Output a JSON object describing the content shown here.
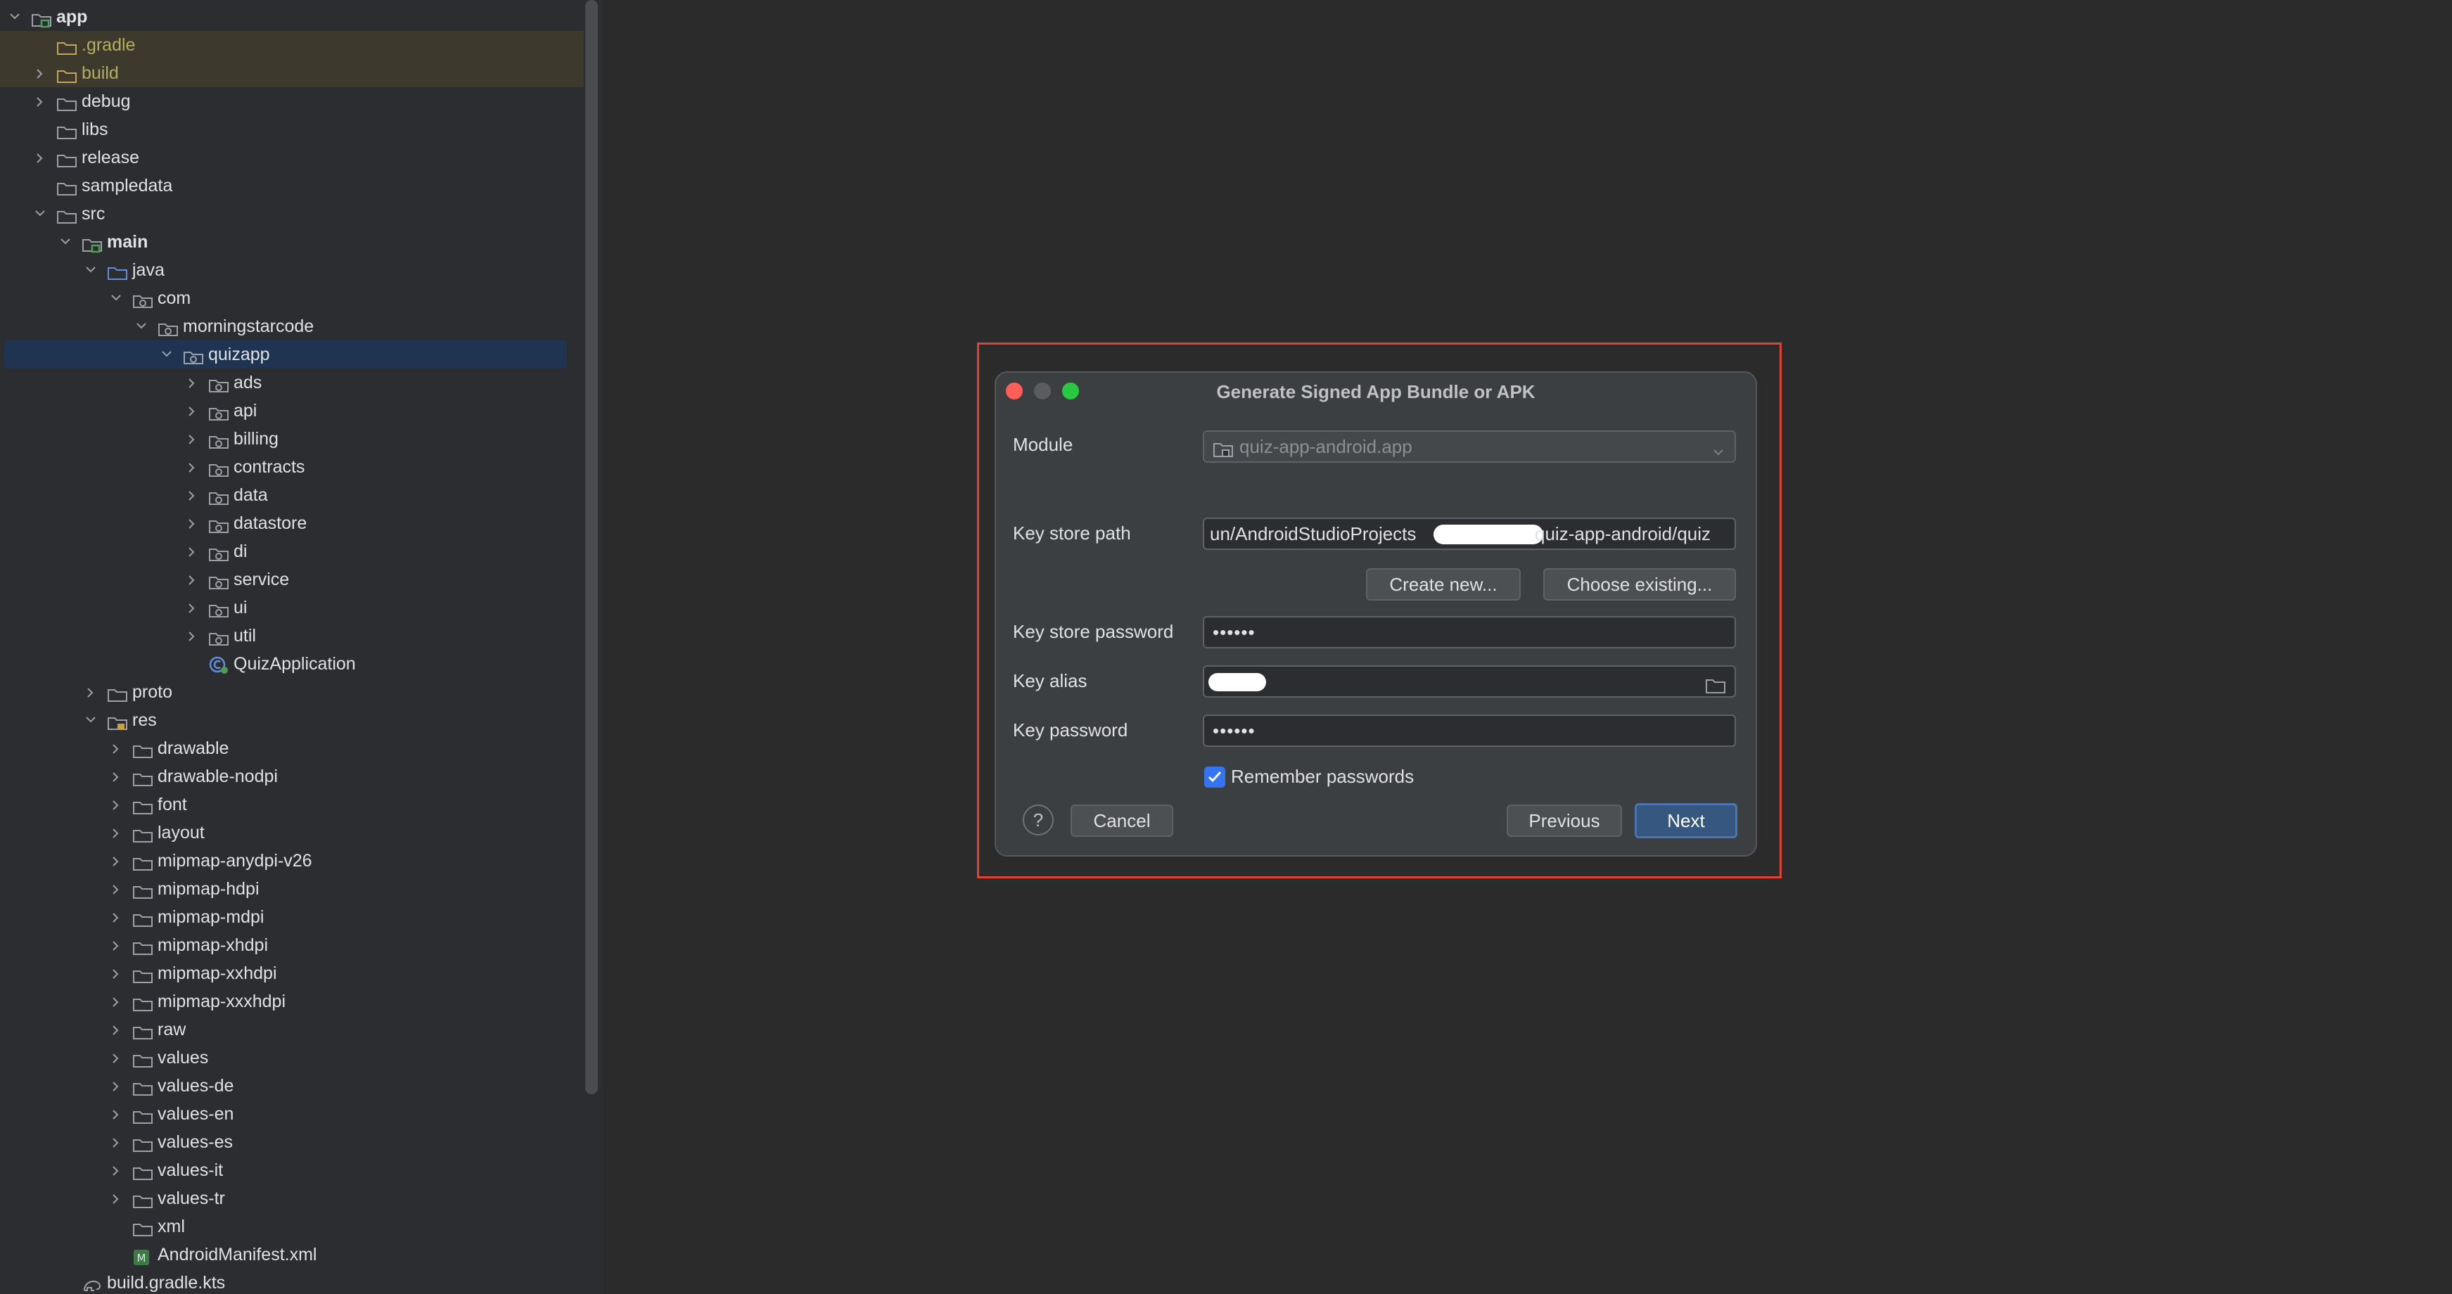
{
  "tree": {
    "items": [
      {
        "label": "app",
        "depth": 0,
        "chevron": "down",
        "icon": "module",
        "bold": true
      },
      {
        "label": ".gradle",
        "depth": 1,
        "chevron": "none",
        "icon": "folder-excluded",
        "highlight": true,
        "excluded": true
      },
      {
        "label": "build",
        "depth": 1,
        "chevron": "right",
        "icon": "folder-excluded",
        "highlight": true,
        "excluded": true
      },
      {
        "label": "debug",
        "depth": 1,
        "chevron": "right",
        "icon": "folder"
      },
      {
        "label": "libs",
        "depth": 1,
        "chevron": "none",
        "icon": "folder"
      },
      {
        "label": "release",
        "depth": 1,
        "chevron": "right",
        "icon": "folder"
      },
      {
        "label": "sampledata",
        "depth": 1,
        "chevron": "none",
        "icon": "folder"
      },
      {
        "label": "src",
        "depth": 1,
        "chevron": "down",
        "icon": "folder"
      },
      {
        "label": "main",
        "depth": 2,
        "chevron": "down",
        "icon": "module",
        "bold": true
      },
      {
        "label": "java",
        "depth": 3,
        "chevron": "down",
        "icon": "folder-source"
      },
      {
        "label": "com",
        "depth": 4,
        "chevron": "down",
        "icon": "package"
      },
      {
        "label": "morningstarcode",
        "depth": 5,
        "chevron": "down",
        "icon": "package"
      },
      {
        "label": "quizapp",
        "depth": 6,
        "chevron": "down",
        "icon": "package",
        "selected": true
      },
      {
        "label": "ads",
        "depth": 7,
        "chevron": "right",
        "icon": "package"
      },
      {
        "label": "api",
        "depth": 7,
        "chevron": "right",
        "icon": "package"
      },
      {
        "label": "billing",
        "depth": 7,
        "chevron": "right",
        "icon": "package"
      },
      {
        "label": "contracts",
        "depth": 7,
        "chevron": "right",
        "icon": "package"
      },
      {
        "label": "data",
        "depth": 7,
        "chevron": "right",
        "icon": "package"
      },
      {
        "label": "datastore",
        "depth": 7,
        "chevron": "right",
        "icon": "package"
      },
      {
        "label": "di",
        "depth": 7,
        "chevron": "right",
        "icon": "package"
      },
      {
        "label": "service",
        "depth": 7,
        "chevron": "right",
        "icon": "package"
      },
      {
        "label": "ui",
        "depth": 7,
        "chevron": "right",
        "icon": "package"
      },
      {
        "label": "util",
        "depth": 7,
        "chevron": "right",
        "icon": "package"
      },
      {
        "label": "QuizApplication",
        "depth": 7,
        "chevron": "none",
        "icon": "class"
      },
      {
        "label": "proto",
        "depth": 3,
        "chevron": "right",
        "icon": "folder"
      },
      {
        "label": "res",
        "depth": 3,
        "chevron": "down",
        "icon": "folder-res"
      },
      {
        "label": "drawable",
        "depth": 4,
        "chevron": "right",
        "icon": "folder"
      },
      {
        "label": "drawable-nodpi",
        "depth": 4,
        "chevron": "right",
        "icon": "folder"
      },
      {
        "label": "font",
        "depth": 4,
        "chevron": "right",
        "icon": "folder"
      },
      {
        "label": "layout",
        "depth": 4,
        "chevron": "right",
        "icon": "folder"
      },
      {
        "label": "mipmap-anydpi-v26",
        "depth": 4,
        "chevron": "right",
        "icon": "folder"
      },
      {
        "label": "mipmap-hdpi",
        "depth": 4,
        "chevron": "right",
        "icon": "folder"
      },
      {
        "label": "mipmap-mdpi",
        "depth": 4,
        "chevron": "right",
        "icon": "folder"
      },
      {
        "label": "mipmap-xhdpi",
        "depth": 4,
        "chevron": "right",
        "icon": "folder"
      },
      {
        "label": "mipmap-xxhdpi",
        "depth": 4,
        "chevron": "right",
        "icon": "folder"
      },
      {
        "label": "mipmap-xxxhdpi",
        "depth": 4,
        "chevron": "right",
        "icon": "folder"
      },
      {
        "label": "raw",
        "depth": 4,
        "chevron": "right",
        "icon": "folder"
      },
      {
        "label": "values",
        "depth": 4,
        "chevron": "right",
        "icon": "folder"
      },
      {
        "label": "values-de",
        "depth": 4,
        "chevron": "right",
        "icon": "folder"
      },
      {
        "label": "values-en",
        "depth": 4,
        "chevron": "right",
        "icon": "folder"
      },
      {
        "label": "values-es",
        "depth": 4,
        "chevron": "right",
        "icon": "folder"
      },
      {
        "label": "values-it",
        "depth": 4,
        "chevron": "right",
        "icon": "folder"
      },
      {
        "label": "values-tr",
        "depth": 4,
        "chevron": "right",
        "icon": "folder"
      },
      {
        "label": "xml",
        "depth": 4,
        "chevron": "none",
        "icon": "folder"
      },
      {
        "label": "AndroidManifest.xml",
        "depth": 4,
        "chevron": "none",
        "icon": "manifest"
      },
      {
        "label": "build.gradle.kts",
        "depth": 2,
        "chevron": "none",
        "icon": "gradle"
      }
    ]
  },
  "dialog": {
    "title": "Generate Signed App Bundle or APK",
    "module_label": "Module",
    "module_value": "quiz-app-android.app",
    "keystore_path_label": "Key store path",
    "keystore_path_prefix": "un/AndroidStudioProjects",
    "keystore_path_suffix": "quiz-app-android/quiz",
    "create_new_label": "Create new...",
    "choose_existing_label": "Choose existing...",
    "keystore_password_label": "Key store password",
    "keystore_password_value": "••••••",
    "key_alias_label": "Key alias",
    "key_password_label": "Key password",
    "key_password_value": "••••••",
    "remember_passwords_label": "Remember passwords",
    "remember_passwords_checked": true,
    "help_label": "?",
    "cancel_label": "Cancel",
    "previous_label": "Previous",
    "next_label": "Next"
  },
  "colors": {
    "accent": "#4b74b5",
    "selection": "#1e3451",
    "excluded_text": "#b3ae60",
    "frame_highlight": "#e0432e"
  }
}
